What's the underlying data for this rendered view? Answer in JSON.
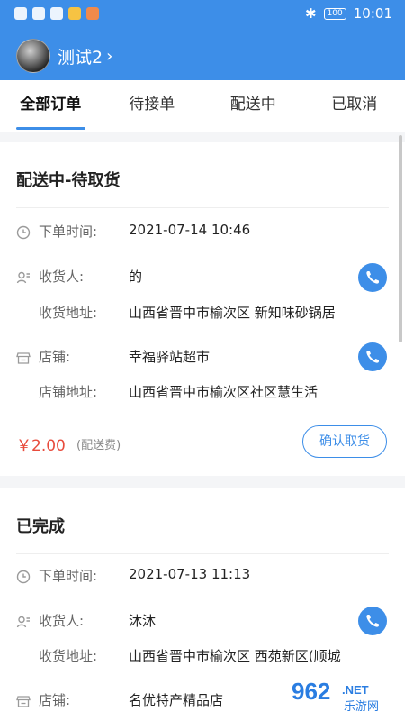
{
  "status_bar": {
    "time": "10:01",
    "battery": "100"
  },
  "user": {
    "name": "测试2"
  },
  "tabs": [
    {
      "label": "全部订单",
      "active": true
    },
    {
      "label": "待接单",
      "active": false
    },
    {
      "label": "配送中",
      "active": false
    },
    {
      "label": "已取消",
      "active": false
    }
  ],
  "orders": [
    {
      "status": "配送中-待取货",
      "order_time_label": "下单时间:",
      "order_time": "2021-07-14 10:46",
      "receiver_label": "收货人:",
      "receiver": "的",
      "receiver_address_label": "收货地址:",
      "receiver_address": "山西省晋中市榆次区 新知味砂锅居",
      "store_label": "店铺:",
      "store": "幸福驿站超市",
      "store_address_label": "店铺地址:",
      "store_address": "山西省晋中市榆次区社区慧生活",
      "price": "￥2.00",
      "fee_note": "(配送费)",
      "action_label": "确认取货"
    },
    {
      "status": "已完成",
      "order_time_label": "下单时间:",
      "order_time": "2021-07-13 11:13",
      "receiver_label": "收货人:",
      "receiver": "沐沐",
      "receiver_address_label": "收货地址:",
      "receiver_address": "山西省晋中市榆次区 西苑新区(顺城",
      "store_label": "店铺:",
      "store": "名优特产精品店"
    }
  ],
  "watermark": {
    "number": "962",
    "suffix": ".NET",
    "sub": "乐游网"
  },
  "colors": {
    "primary": "#3d8ee8",
    "price": "#e84c3d",
    "background": "#f4f5f7"
  }
}
